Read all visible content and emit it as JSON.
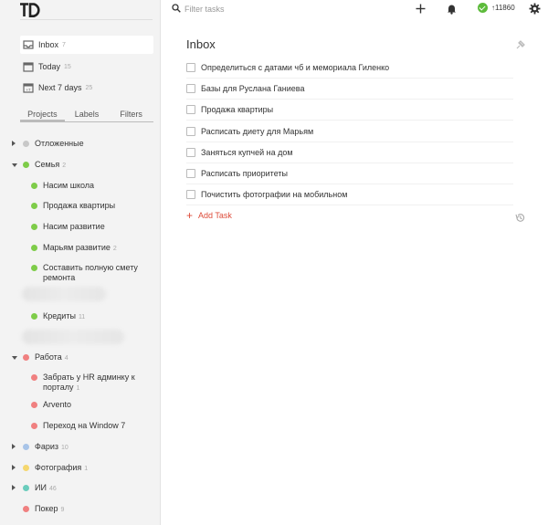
{
  "search": {
    "placeholder": "Filter tasks"
  },
  "karma": {
    "score": "↑11860",
    "color": "#5dbb3b"
  },
  "filters": [
    {
      "label": "Inbox",
      "count": "7",
      "icon": "inbox-icon"
    },
    {
      "label": "Today",
      "count": "15",
      "icon": "calendar-today-icon"
    },
    {
      "label": "Next 7 days",
      "count": "25",
      "icon": "calendar-week-icon"
    }
  ],
  "tabs": [
    {
      "label": "Projects"
    },
    {
      "label": "Labels"
    },
    {
      "label": "Filters"
    }
  ],
  "projects": [
    {
      "name": "Отложенные",
      "count": "",
      "color": "#c8c8c8"
    },
    {
      "name": "Семья",
      "count": "2",
      "color": "#7ecc49"
    },
    {
      "name": "Насим школа",
      "count": "",
      "color": "#7ecc49"
    },
    {
      "name": "Продажа квартиры",
      "count": "",
      "color": "#7ecc49"
    },
    {
      "name": "Насим развитие",
      "count": "",
      "color": "#7ecc49"
    },
    {
      "name": "Марьям развитие",
      "count": "2",
      "color": "#7ecc49"
    },
    {
      "name": "Составить полную смету ремонта",
      "count": "",
      "color": "#7ecc49"
    },
    {
      "name": "Кредиты",
      "count": "11",
      "color": "#7ecc49"
    },
    {
      "name": "Работа",
      "count": "4",
      "color": "#f08080"
    },
    {
      "name": "Забрать у HR админку к порталу",
      "count": "1",
      "color": "#f08080"
    },
    {
      "name": "Arvento",
      "count": "",
      "color": "#f08080"
    },
    {
      "name": "Переход на Window 7",
      "count": "",
      "color": "#f08080"
    },
    {
      "name": "Фариз",
      "count": "10",
      "color": "#a8c4e8"
    },
    {
      "name": "Фотография",
      "count": "1",
      "color": "#f5d76e"
    },
    {
      "name": "ИИ",
      "count": "46",
      "color": "#6accbc"
    },
    {
      "name": "Покер",
      "count": "9",
      "color": "#f08080"
    }
  ],
  "main": {
    "title": "Inbox",
    "tasks": [
      {
        "label": "Определиться с датами чб и мемориала Гиленко"
      },
      {
        "label": "Базы для Руслана Ганиева"
      },
      {
        "label": "Продажа квартиры"
      },
      {
        "label": "Расписать диету для Марьям"
      },
      {
        "label": "Заняться купчей на дом"
      },
      {
        "label": "Расписать приоритеты"
      },
      {
        "label": "Почистить фотографии на мобильном"
      }
    ],
    "add_task_label": "Add Task"
  }
}
